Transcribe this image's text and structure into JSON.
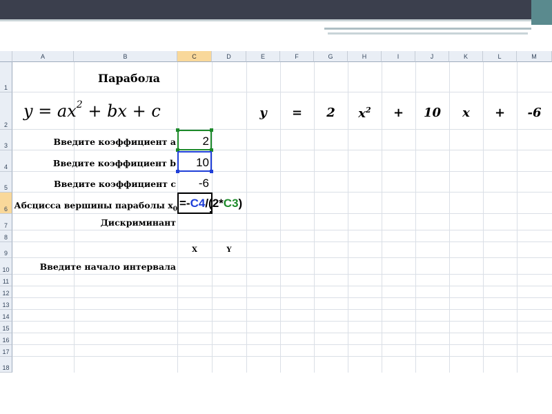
{
  "columns": [
    "A",
    "B",
    "C",
    "D",
    "E",
    "F",
    "G",
    "H",
    "I",
    "J",
    "K",
    "L",
    "M"
  ],
  "rows": [
    "1",
    "2",
    "3",
    "4",
    "5",
    "6",
    "7",
    "8",
    "9",
    "10",
    "11",
    "12",
    "13",
    "14",
    "15",
    "16",
    "17",
    "18"
  ],
  "title": "Парабола",
  "formula": {
    "lhs": "y = ax",
    "exp": "2",
    "rhs": " + bx + c"
  },
  "equation": {
    "y": "y",
    "eq": "=",
    "a": "2",
    "x": "x",
    "x_exp": "2",
    "plus1": "+",
    "b": "10",
    "x2": "x",
    "plus2": "+",
    "c": "-6"
  },
  "labels": {
    "coef_a": "Введите коэффициент a",
    "coef_b": "Введите коэффициент b",
    "coef_c": "Введите коэффициент c",
    "vertex": "Абсцисса вершины параболы x",
    "vertex_sub": "0",
    "discriminant": "Дискриминант",
    "interval_start": "Введите начало интервала"
  },
  "values": {
    "a": "2",
    "b": "10",
    "c": "-6"
  },
  "edit_formula": {
    "prefix": "=-",
    "ref1": "C4",
    "mid": "/(2*",
    "ref2": "C3",
    "suffix": ")"
  },
  "table_headers": {
    "x": "X",
    "y": "Y"
  },
  "colors": {
    "ref_blue": "#1f3fd8",
    "ref_green": "#1d8a2a",
    "selected_header": "#f9d89a"
  }
}
